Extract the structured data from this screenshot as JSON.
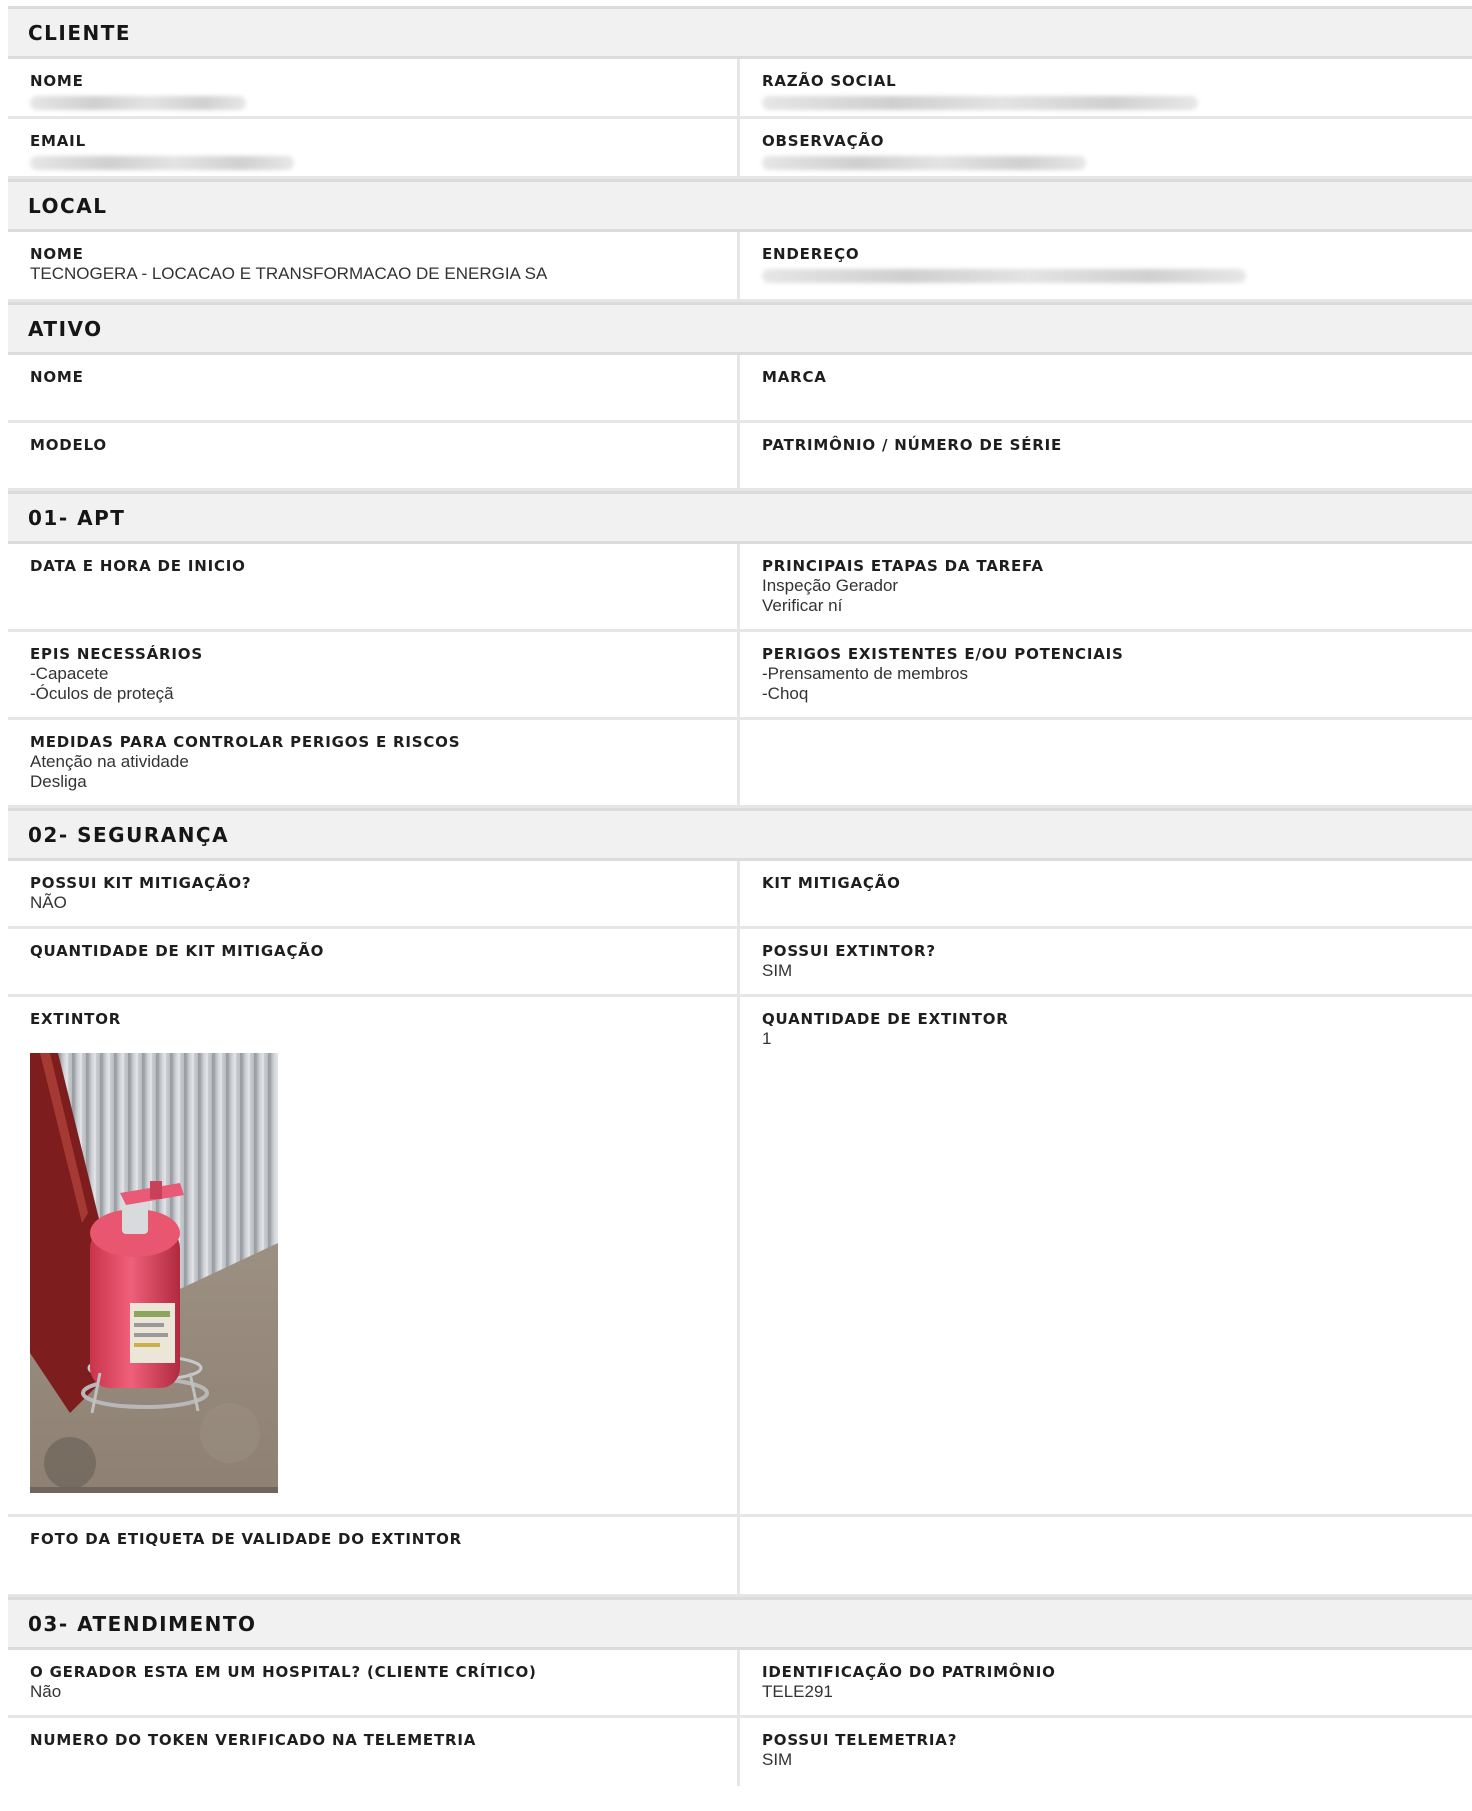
{
  "cliente": {
    "title": "CLIENTE",
    "nome_label": "NOME",
    "razao_label": "RAZÃO SOCIAL",
    "email_label": "EMAIL",
    "obs_label": "OBSERVAÇÃO"
  },
  "local": {
    "title": "LOCAL",
    "nome_label": "NOME",
    "nome_value": "TECNOGERA - LOCACAO E TRANSFORMACAO DE ENERGIA SA",
    "endereco_label": "ENDEREÇO"
  },
  "ativo": {
    "title": "ATIVO",
    "nome_label": "NOME",
    "marca_label": "MARCA",
    "modelo_label": "MODELO",
    "patrimonio_label": "PATRIMÔNIO / NÚMERO DE SÉRIE"
  },
  "apt": {
    "title": "01- APT",
    "data_label": "DATA E HORA DE INICIO",
    "etapas_label": "PRINCIPAIS ETAPAS DA TAREFA",
    "etapas_value": "Inspeção Gerador\nVerificar ní",
    "epis_label": "EPIS NECESSÁRIOS",
    "epis_value": "-Capacete\n-Óculos de proteçã",
    "perigos_label": "PERIGOS EXISTENTES E/OU POTENCIAIS",
    "perigos_value": "-Prensamento de membros\n-Choq",
    "medidas_label": "MEDIDAS PARA CONTROLAR PERIGOS E RISCOS",
    "medidas_value": "Atenção na atividade\nDesliga"
  },
  "seguranca": {
    "title": "02- SEGURANÇA",
    "possui_kit_label": "POSSUI KIT MITIGAÇÃO?",
    "possui_kit_value": "NÃO",
    "kit_label": "KIT MITIGAÇÃO",
    "qtd_kit_label": "QUANTIDADE DE KIT MITIGAÇÃO",
    "possui_extintor_label": "POSSUI EXTINTOR?",
    "possui_extintor_value": "SIM",
    "extintor_label": "EXTINTOR",
    "qtd_extintor_label": "QUANTIDADE DE EXTINTOR",
    "qtd_extintor_value": "1",
    "foto_label": "FOTO DA ETIQUETA DE VALIDADE DO EXTINTOR"
  },
  "atendimento": {
    "title": "03- ATENDIMENTO",
    "hospital_label": "O GERADOR ESTA EM UM HOSPITAL? (CLIENTE CRÍTICO)",
    "hospital_value": "Não",
    "ident_label": "IDENTIFICAÇÃO DO PATRIMÔNIO",
    "ident_value": "TELE291",
    "token_label": "NUMERO DO TOKEN VERIFICADO NA TELEMETRIA",
    "telemetria_label": "POSSUI TELEMETRIA?",
    "telemetria_value": "SIM"
  }
}
